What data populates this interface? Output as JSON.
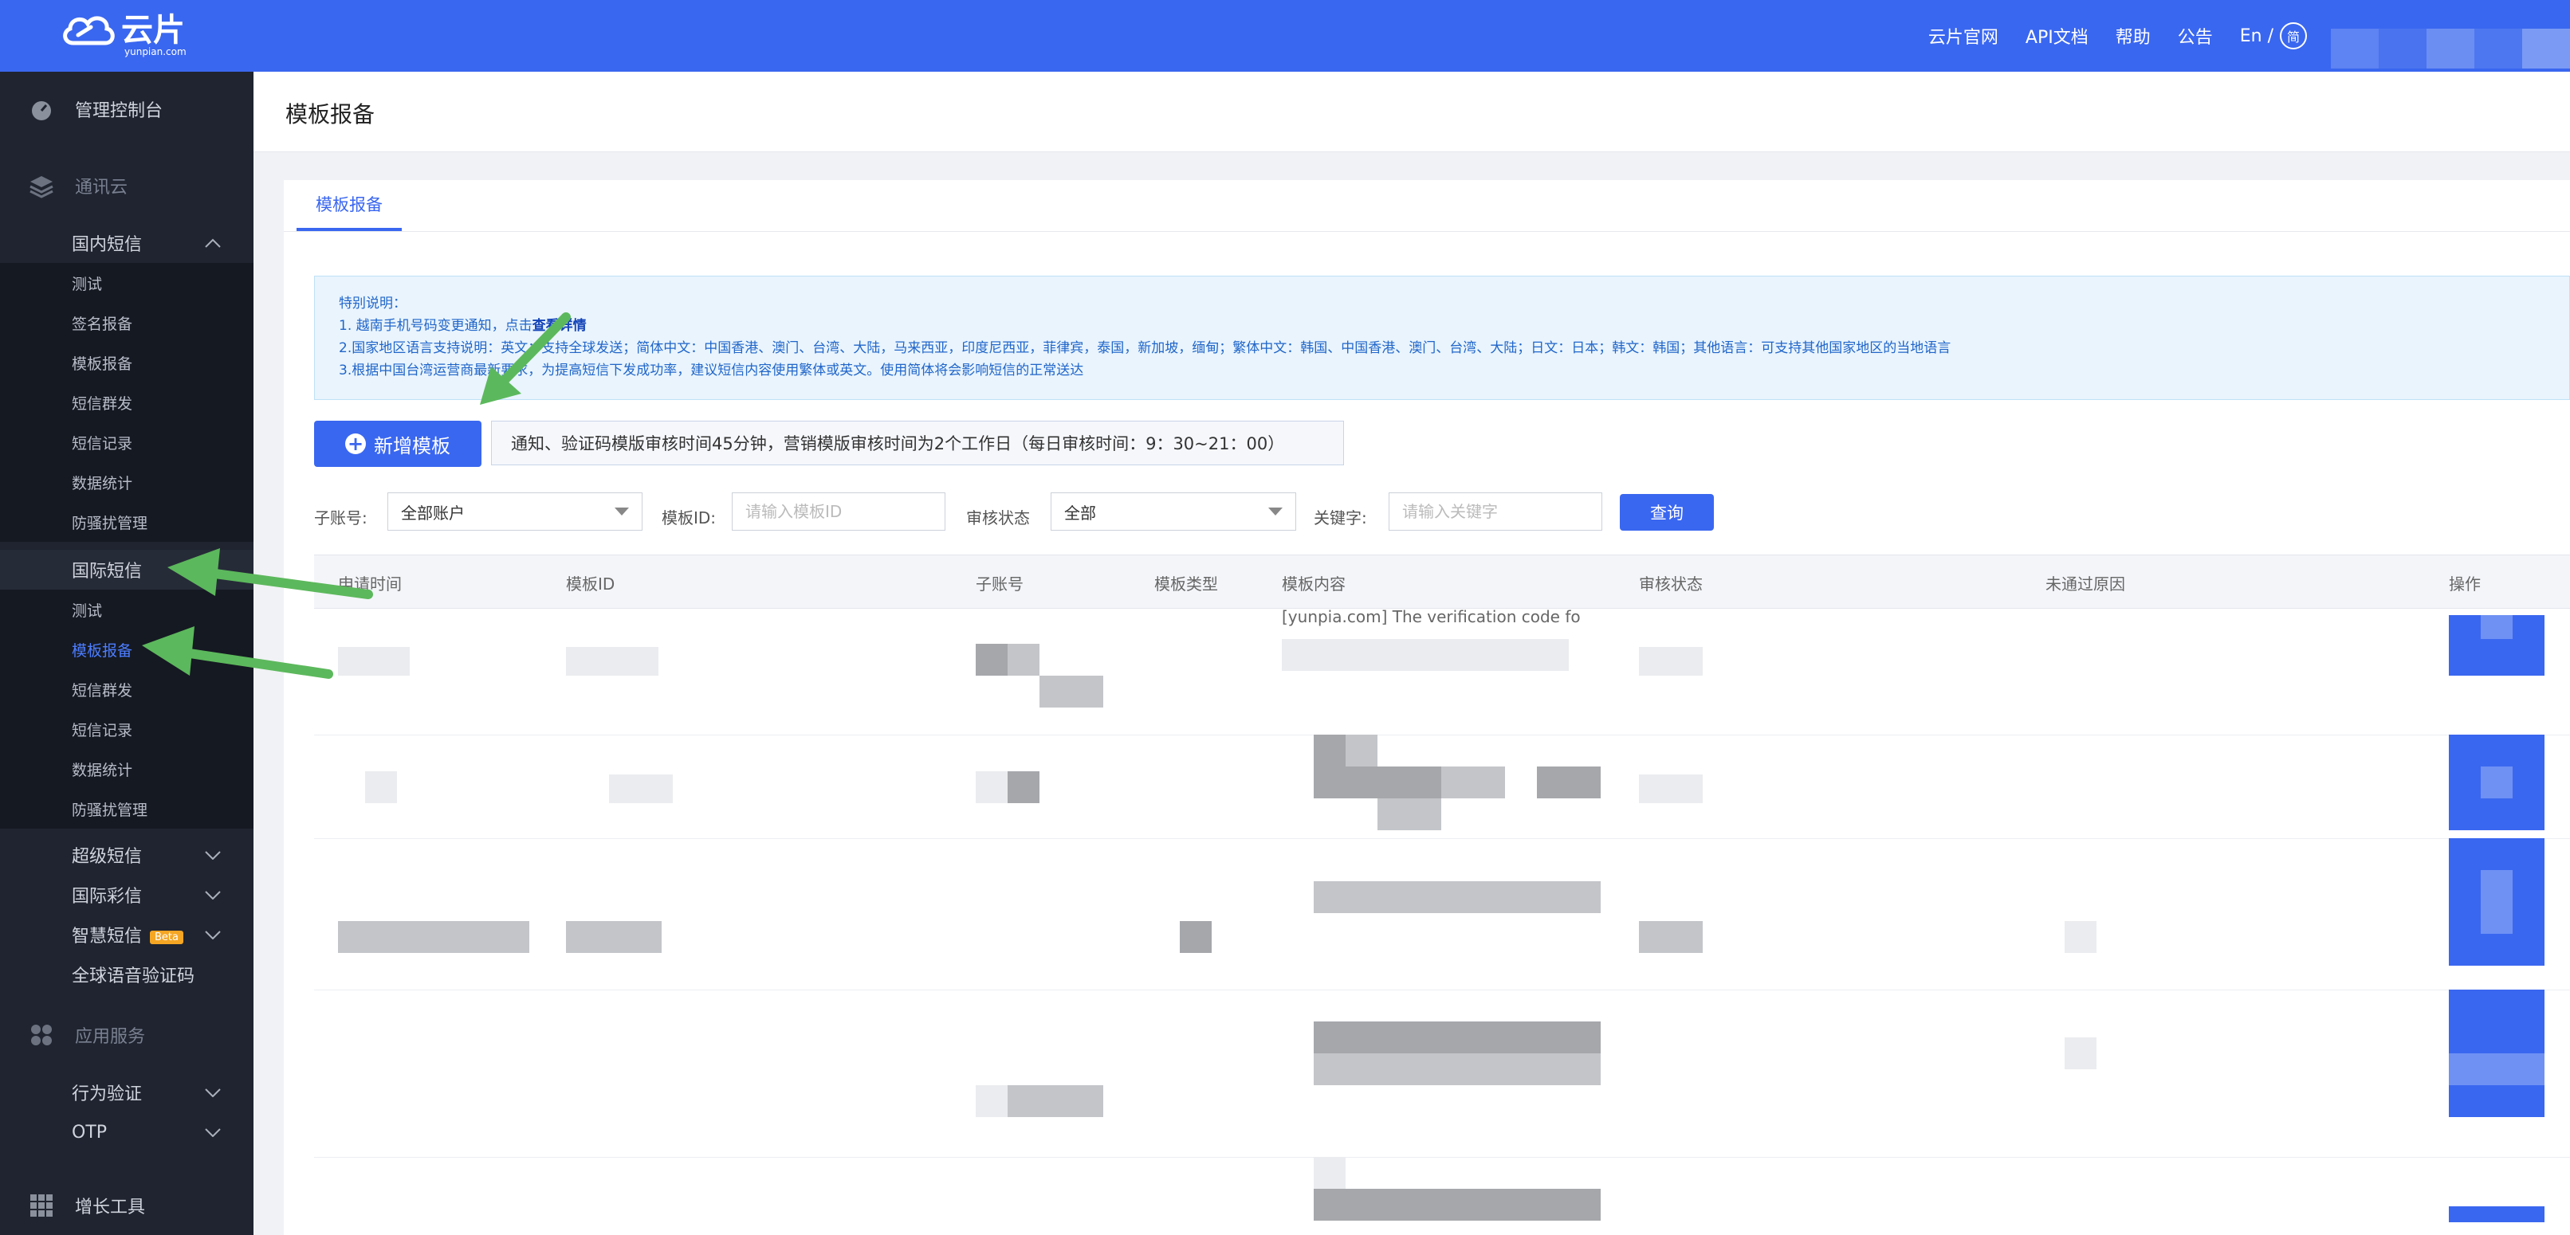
{
  "header": {
    "brand": "云片",
    "brand_sub": "yunpian.com",
    "nav": [
      "云片官网",
      "API文档",
      "帮助",
      "公告"
    ],
    "lang": "En /",
    "lang_circle": "简"
  },
  "sidebar": {
    "console": "管理控制台",
    "section_comm": "通讯云",
    "domestic": "国内短信",
    "domestic_items": [
      "测试",
      "签名报备",
      "模板报备",
      "短信群发",
      "短信记录",
      "数据统计",
      "防骚扰管理"
    ],
    "international": "国际短信",
    "international_items": [
      "测试",
      "模板报备",
      "短信群发",
      "短信记录",
      "数据统计",
      "防骚扰管理"
    ],
    "super_sms": "超级短信",
    "intl_mms": "国际彩信",
    "smart_sms": "智慧短信",
    "beta": "Beta",
    "voice": "全球语音验证码",
    "section_app": "应用服务",
    "behavior": "行为验证",
    "otp": "OTP",
    "growth": "增长工具"
  },
  "page": {
    "title": "模板报备",
    "tab": "模板报备"
  },
  "notice": {
    "heading": "特别说明：",
    "line1_a": "1. 越南手机号码变更通知，点击",
    "line1_link": "查看详情",
    "line2": "2.国家地区语言支持说明：英文：支持全球发送；简体中文：中国香港、澳门、台湾、大陆，马来西亚，印度尼西亚，菲律宾，泰国，新加坡，缅甸；繁体中文：韩国、中国香港、澳门、台湾、大陆；日文：日本；韩文：韩国；其他语言：可支持其他国家地区的当地语言",
    "line3": "3.根据中国台湾运营商最新要求，为提高短信下发成功率，建议短信内容使用繁体或英文。使用简体将会影响短信的正常送达"
  },
  "actions": {
    "add_template": "新增模板",
    "review_tip": "通知、验证码模版审核时间45分钟，营销模版审核时间为2个工作日（每日审核时间：9：30~21：00）"
  },
  "filters": {
    "sub_account_label": "子账号:",
    "sub_account_value": "全部账户",
    "template_id_label": "模板ID:",
    "template_id_placeholder": "请输入模板ID",
    "status_label": "审核状态",
    "status_value": "全部",
    "keyword_label": "关键字:",
    "keyword_placeholder": "请输入关键字",
    "query": "查询"
  },
  "table": {
    "headers": [
      "申请时间",
      "模板ID",
      "子账号",
      "模板类型",
      "模板内容",
      "审核状态",
      "未通过原因",
      "操作"
    ],
    "row1_content_snippet": "[yunpia.com] The verification code fo"
  }
}
